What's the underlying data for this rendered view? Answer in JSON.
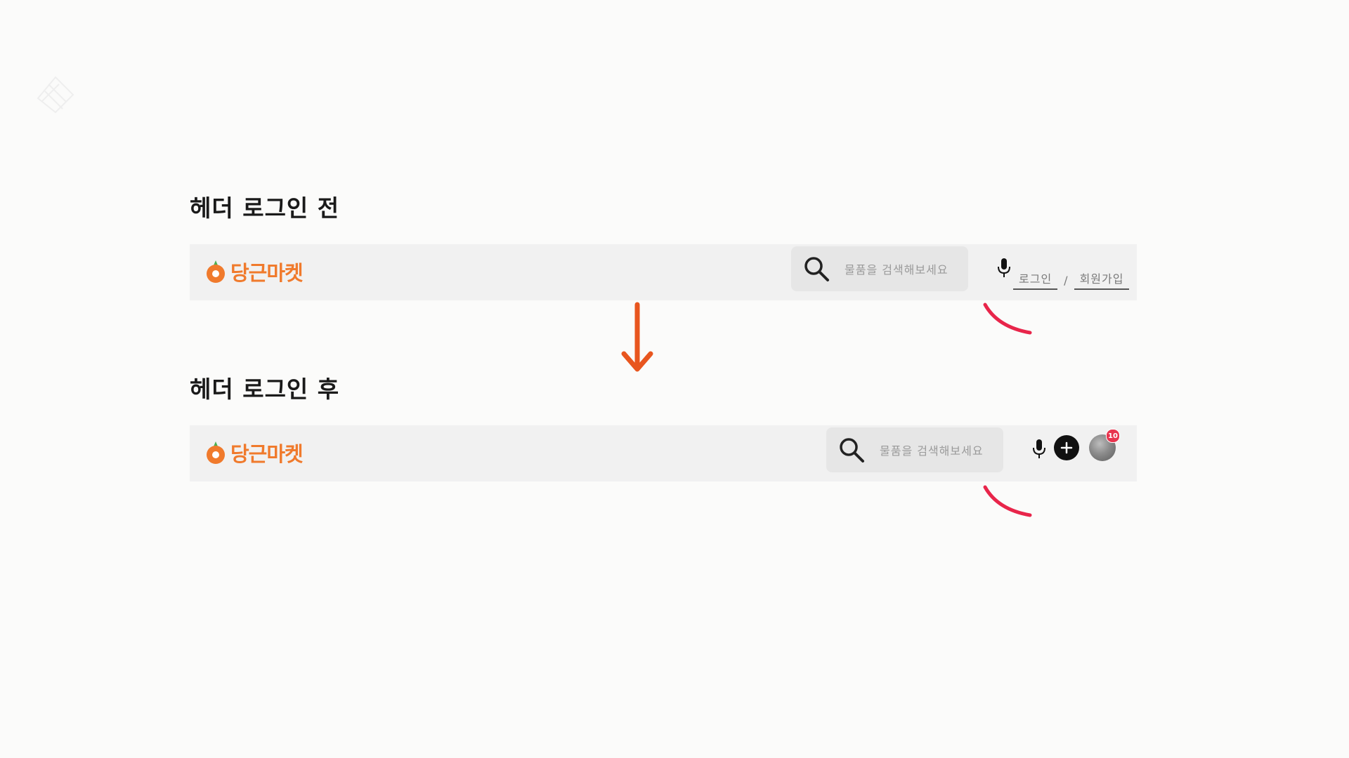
{
  "before": {
    "title": "헤더 로그인 전",
    "logo_text": "당근마켓",
    "search_placeholder": "물품을 검색해보세요",
    "login_label": "로그인",
    "separator": "/",
    "signup_label": "회원가입"
  },
  "after": {
    "title": "헤더 로그인 후",
    "logo_text": "당근마켓",
    "search_placeholder": "물품을 검색해보세요",
    "notification_count": "10"
  },
  "colors": {
    "brand": "#f07a2c",
    "arrow": "#e8561f",
    "highlight_curve": "#e8254a",
    "badge": "#e8344e"
  },
  "icons": [
    "carrot-icon",
    "search-icon",
    "microphone-icon",
    "plus-icon",
    "avatar",
    "down-arrow-icon"
  ]
}
